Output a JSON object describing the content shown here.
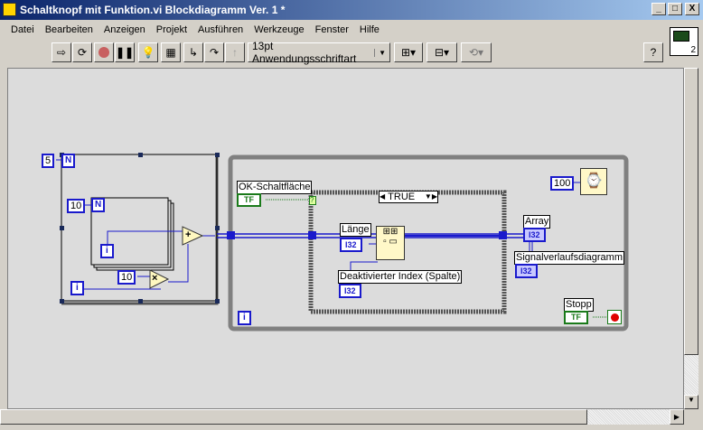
{
  "window": {
    "title": "Schaltknopf mit Funktion.vi Blockdiagramm Ver. 1 *",
    "min": "_",
    "max": "□",
    "close": "X"
  },
  "menu": [
    "Datei",
    "Bearbeiten",
    "Anzeigen",
    "Projekt",
    "Ausführen",
    "Werkzeuge",
    "Fenster",
    "Hilfe"
  ],
  "toolbar": {
    "font": "13pt Anwendungsschriftart",
    "help": "?",
    "icon_badge": "2"
  },
  "diagram": {
    "outer_count": "5",
    "inner_count": "10",
    "N": "N",
    "i": "i",
    "mult_const": "10",
    "case_selector": "TRUE",
    "case_question": "?",
    "ok_label": "OK-Schaltfläche",
    "bool_tf": "TF",
    "laenge_label": "Länge",
    "i32": "I32",
    "deakt_label": "Deaktivierter Index (Spalte)",
    "array_label": "Array",
    "signal_label": "Signalverlaufsdiagramm",
    "wait_const": "100",
    "stop_label": "Stopp",
    "add": "+",
    "mult": "×"
  },
  "colors": {
    "wire": "#1a1acc",
    "bool": "#1a7a1a",
    "while": "#808080"
  }
}
